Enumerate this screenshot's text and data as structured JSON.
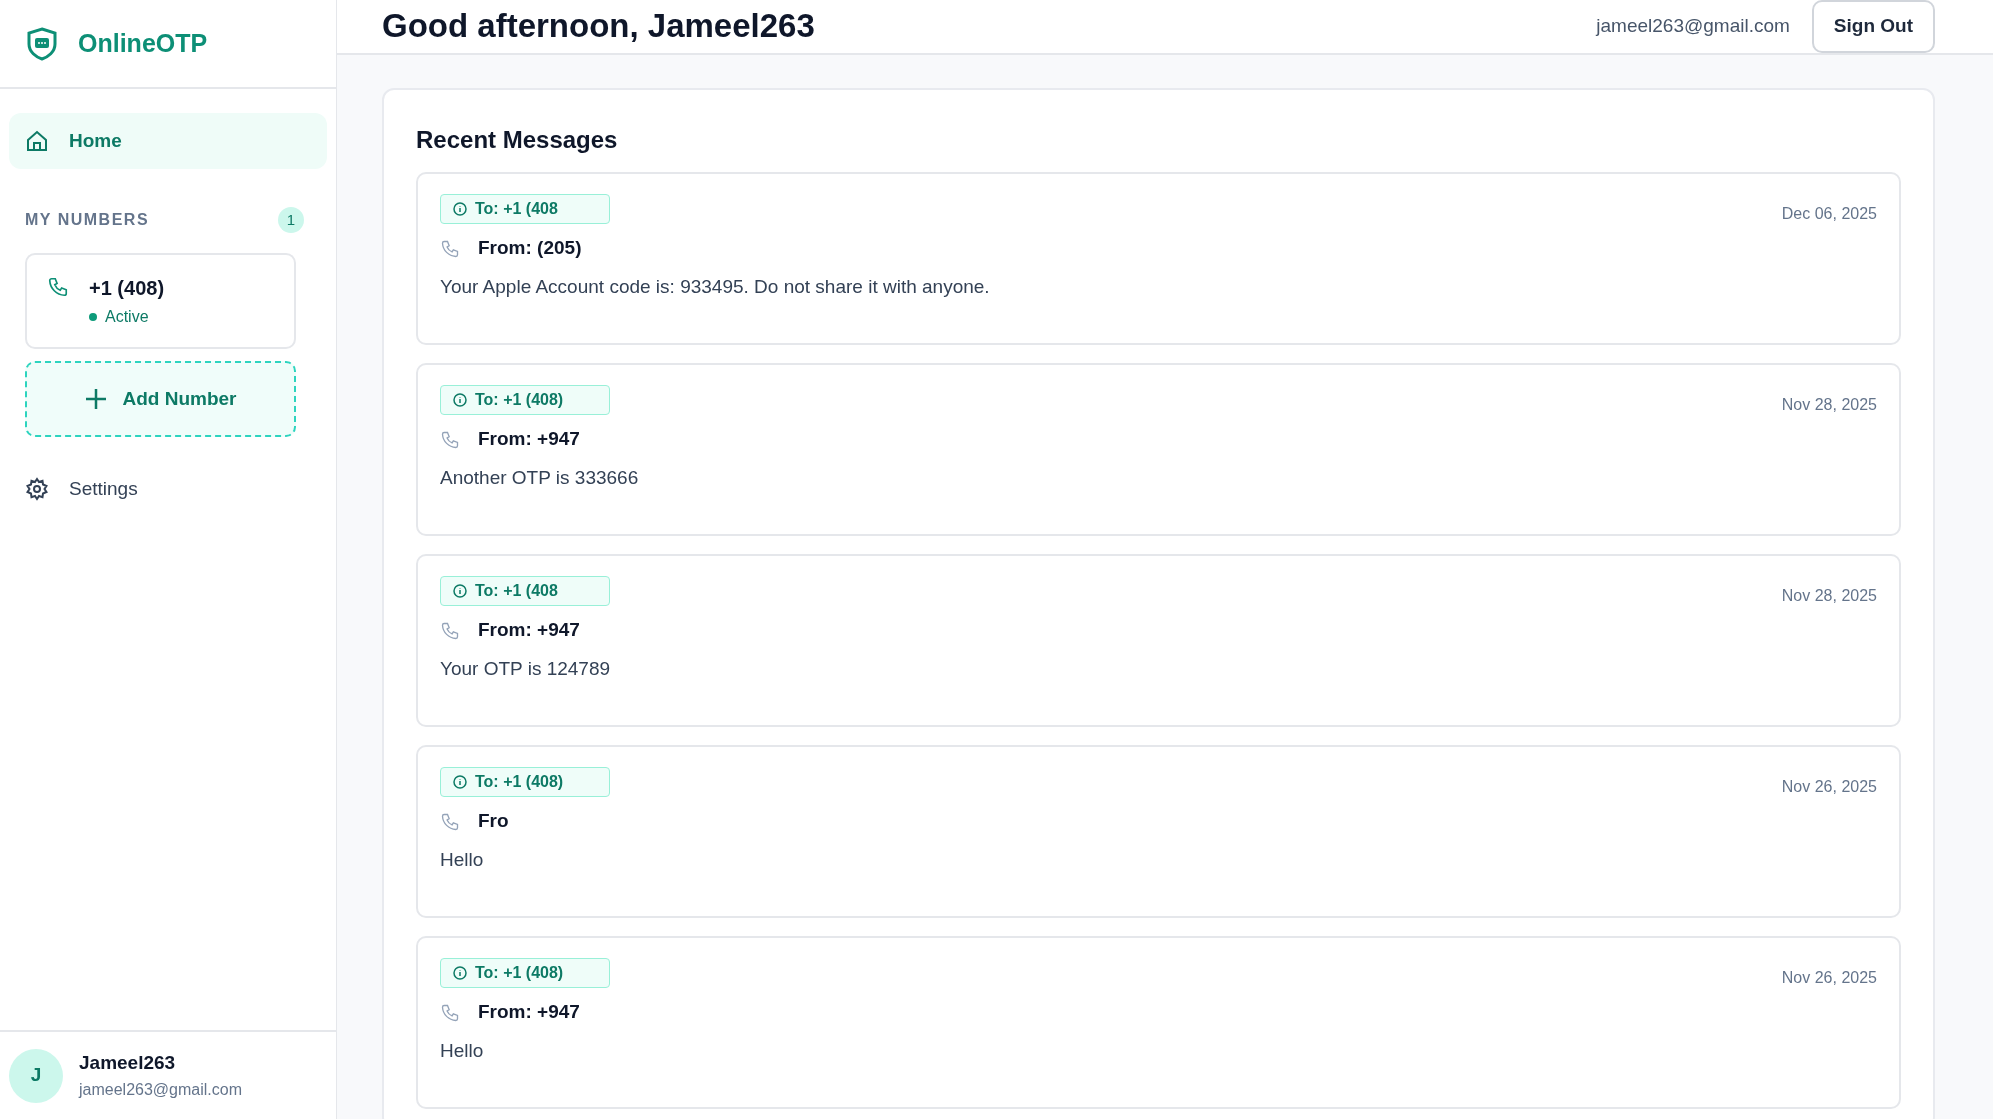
{
  "sidebar": {
    "brand": "OnlineOTP",
    "home": {
      "label": "Home",
      "selected": true
    },
    "numbers_heading": "MY NUMBERS",
    "numbers_count": "1",
    "numbers": [
      {
        "number": "+1 (408)",
        "status": "Active",
        "active": true
      }
    ],
    "add_button": "Add Number",
    "settings": {
      "label": "Settings",
      "selected": false
    },
    "user": {
      "initial": "J",
      "name": "Jameel263",
      "email": "jameel263@gmail.com"
    }
  },
  "header": {
    "greeting": "Good afternoon, Jameel263",
    "email": "jameel263@gmail.com",
    "sign_out": "Sign Out"
  },
  "messages": {
    "title": "Recent Messages",
    "items": [
      {
        "to": "To: +1 (408",
        "from": "From: (205)",
        "body": "Your Apple Account code is: 933495. Do not share it with anyone.",
        "date": "Dec 06, 2025"
      },
      {
        "to": "To: +1 (408)",
        "from": "From: +947",
        "body": "Another OTP is 333666",
        "date": "Nov 28, 2025"
      },
      {
        "to": "To: +1 (408",
        "from": "From: +947",
        "body": "Your OTP is 124789",
        "date": "Nov 28, 2025"
      },
      {
        "to": "To: +1 (408)",
        "from": "Fro",
        "body": "Hello",
        "date": "Nov 26, 2025"
      },
      {
        "to": "To: +1 (408)",
        "from": "From: +947",
        "body": "Hello",
        "date": "Nov 26, 2025"
      }
    ]
  }
}
